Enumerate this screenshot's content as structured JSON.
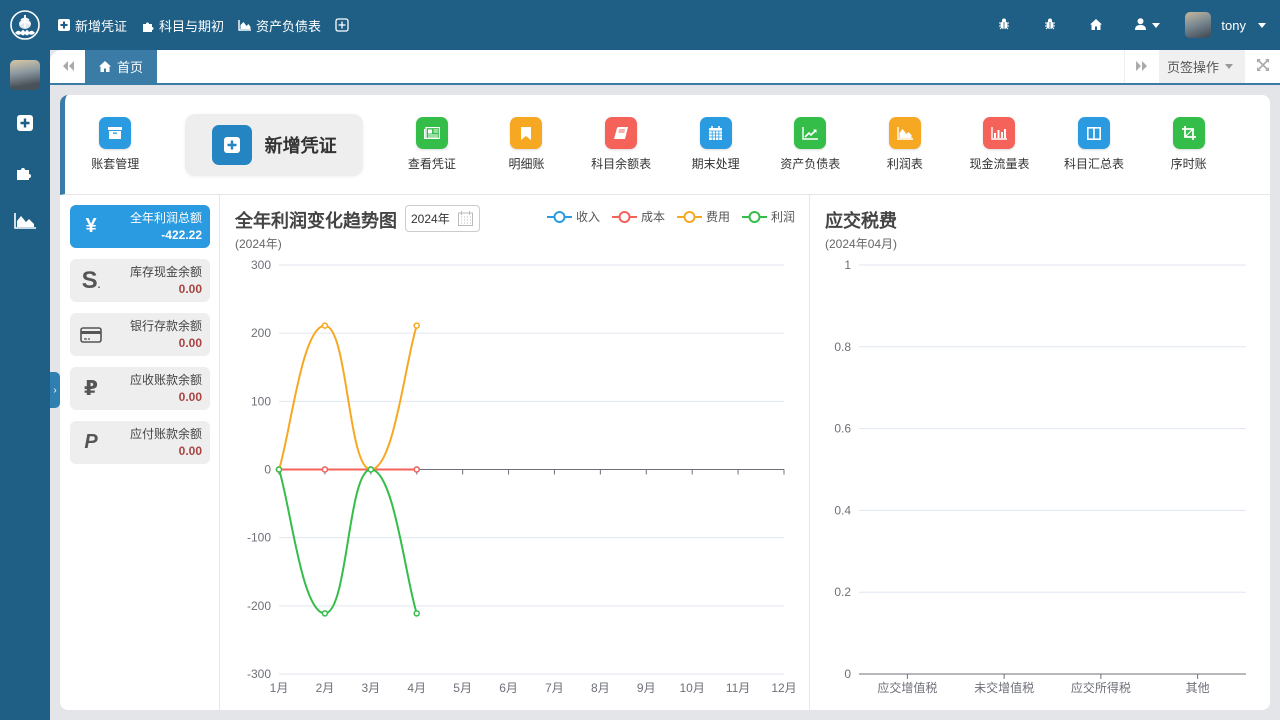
{
  "topbar": {
    "logo": "tree-cloud-logo",
    "nav": [
      {
        "label": "新增凭证",
        "icon": "plus-square-icon"
      },
      {
        "label": "科目与期初",
        "icon": "puzzle-icon"
      },
      {
        "label": "资产负债表",
        "icon": "area-chart-icon"
      },
      {
        "label": "",
        "icon": "add-tab-icon"
      }
    ],
    "right_icons": [
      "bug-icon",
      "bug-icon",
      "home-icon",
      "user-icon"
    ],
    "username": "tony"
  },
  "sidebar": {
    "items": [
      {
        "icon": "plus-square-icon"
      },
      {
        "icon": "puzzle-icon"
      },
      {
        "icon": "area-chart-icon"
      }
    ]
  },
  "tabs": {
    "home_label": "首页",
    "ops_label": "页签操作"
  },
  "quick": {
    "items": [
      {
        "label": "账套管理",
        "icon": "archive-icon",
        "color": "#2a9be0"
      },
      {
        "label": "新增凭证",
        "icon": "plus-square-icon",
        "color": "#2585c2",
        "big": true
      },
      {
        "label": "查看凭证",
        "icon": "newspaper-icon",
        "color": "#35bd4a"
      },
      {
        "label": "明细账",
        "icon": "bookmark-icon",
        "color": "#f7a823"
      },
      {
        "label": "科目余额表",
        "icon": "book-icon",
        "color": "#f4625a"
      },
      {
        "label": "期末处理",
        "icon": "calendar-icon",
        "color": "#2a9be0"
      },
      {
        "label": "资产负债表",
        "icon": "line-chart-icon",
        "color": "#35bd4a"
      },
      {
        "label": "利润表",
        "icon": "area-chart-icon",
        "color": "#f7a823"
      },
      {
        "label": "现金流量表",
        "icon": "bar-chart-icon",
        "color": "#f4625a"
      },
      {
        "label": "科目汇总表",
        "icon": "columns-icon",
        "color": "#2a9be0"
      },
      {
        "label": "序时账",
        "icon": "crop-icon",
        "color": "#35bd4a"
      }
    ]
  },
  "stats": [
    {
      "label": "全年利润总额",
      "value": "-422.22",
      "icon": "yen-icon",
      "active": true
    },
    {
      "label": "库存现金余额",
      "value": "0.00",
      "icon": "dollar-s-icon"
    },
    {
      "label": "银行存款余额",
      "value": "0.00",
      "icon": "credit-card-icon"
    },
    {
      "label": "应收账款余额",
      "value": "0.00",
      "icon": "ruble-icon"
    },
    {
      "label": "应付账款余额",
      "value": "0.00",
      "icon": "paypal-icon"
    }
  ],
  "chart_data": [
    {
      "type": "line",
      "title": "全年利润变化趋势图",
      "subtitle": "(2024年)",
      "year_picker": "2024年",
      "x": [
        "1月",
        "2月",
        "3月",
        "4月",
        "5月",
        "6月",
        "7月",
        "8月",
        "9月",
        "10月",
        "11月",
        "12月"
      ],
      "ylim": [
        -300,
        300
      ],
      "yticks": [
        300,
        200,
        100,
        0,
        -100,
        -200,
        -300
      ],
      "smooth": true,
      "legend_position": "top-right",
      "series": [
        {
          "name": "收入",
          "color": "#2a9be0",
          "values": [
            0,
            0,
            0,
            0
          ]
        },
        {
          "name": "成本",
          "color": "#f4625a",
          "values": [
            0,
            0,
            0,
            0
          ]
        },
        {
          "name": "费用",
          "color": "#f7a823",
          "values": [
            0,
            211.11,
            0,
            211.11
          ]
        },
        {
          "name": "利润",
          "color": "#35bd4a",
          "values": [
            0,
            -211.11,
            0,
            -211.11
          ]
        }
      ]
    },
    {
      "type": "bar",
      "title": "应交税费",
      "subtitle": "(2024年04月)",
      "categories": [
        "应交增值税",
        "未交增值税",
        "应交所得税",
        "其他"
      ],
      "values": [
        0,
        0,
        0,
        0
      ],
      "ylim": [
        0,
        1
      ],
      "yticks": [
        1,
        0.8,
        0.6,
        0.4,
        0.2,
        0
      ]
    }
  ]
}
